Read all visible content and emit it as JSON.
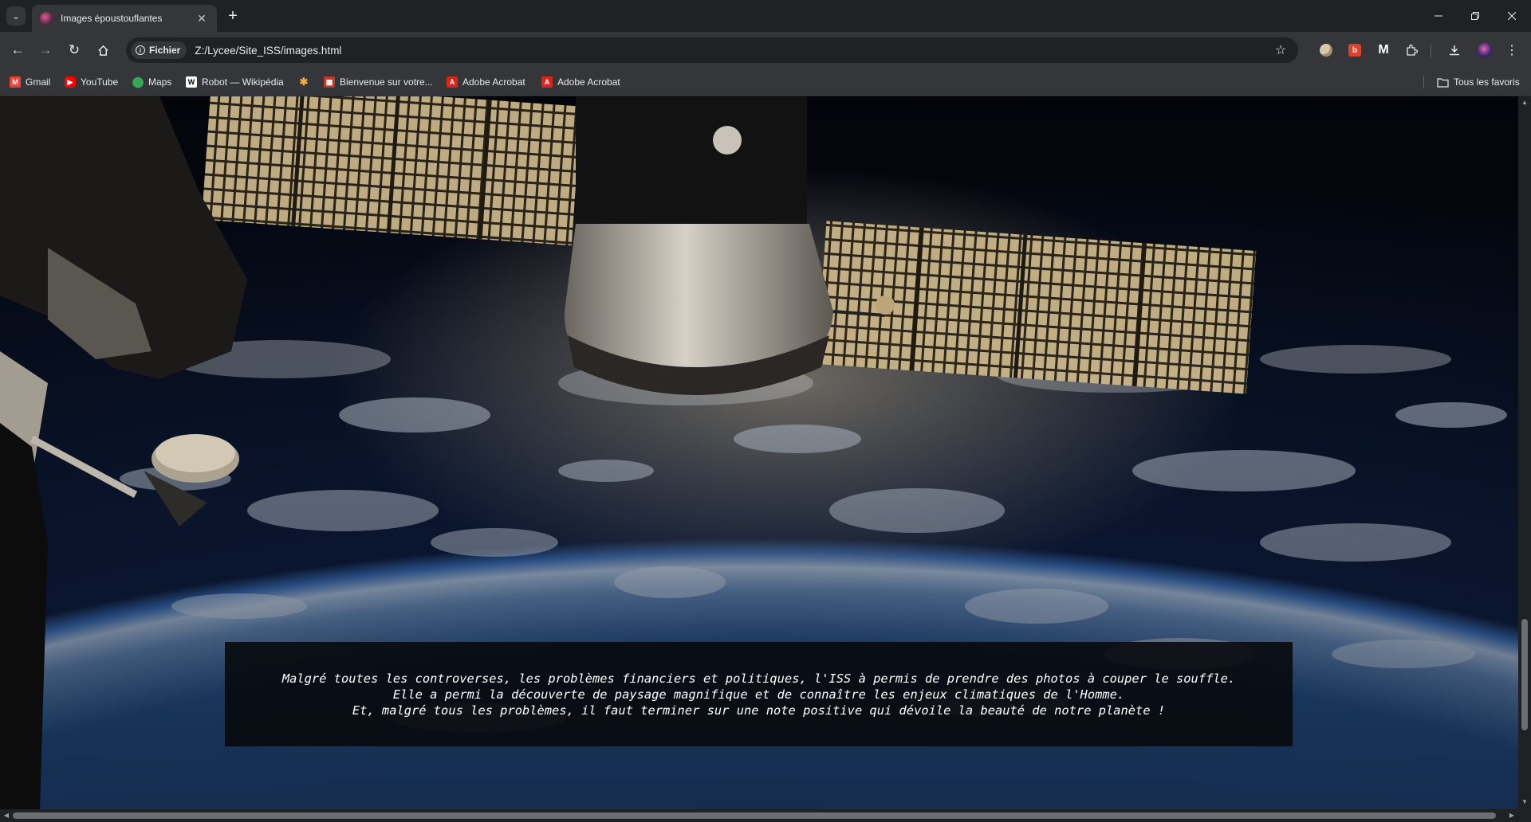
{
  "browser": {
    "tab": {
      "title": "Images époustouflantes"
    },
    "address": {
      "scheme_label": "Fichier",
      "url": "Z:/Lycee/Site_ISS/images.html"
    },
    "bookmarks": [
      {
        "label": "Gmail",
        "icon": "gmail-icon",
        "color": "#ea4335"
      },
      {
        "label": "YouTube",
        "icon": "youtube-icon",
        "color": "#ff0000"
      },
      {
        "label": "Maps",
        "icon": "maps-icon",
        "color": "#34a853"
      },
      {
        "label": "Robot — Wikipédia",
        "icon": "wikipedia-icon",
        "color": "#ffffff"
      },
      {
        "label": "",
        "icon": "joomla-icon",
        "color": "#f9a541"
      },
      {
        "label": "Bienvenue sur votre...",
        "icon": "site-icon",
        "color": "#c0392b"
      },
      {
        "label": "Adobe Acrobat",
        "icon": "acrobat-icon",
        "color": "#d9261c"
      },
      {
        "label": "Adobe Acrobat",
        "icon": "acrobat-icon",
        "color": "#d9261c"
      }
    ],
    "all_bookmarks_label": "Tous les favoris"
  },
  "page": {
    "background_image": "earth-from-iss-photo",
    "caption": {
      "lines": [
        "Malgré toutes les controverses, les problèmes financiers et politiques, l'ISS à permis de prendre des photos à couper le souffle.",
        "Elle a permi la découverte de paysage magnifique et de connaître les enjeux climatiques de l'Homme.",
        "Et, malgré tous les problèmes, il faut terminer sur une note positive qui dévoile la beauté de notre planète !"
      ]
    }
  }
}
